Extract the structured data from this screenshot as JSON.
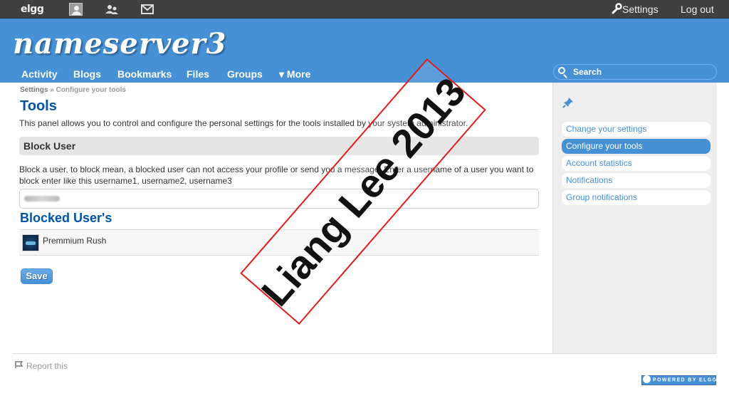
{
  "topbar": {
    "logo_text": "elgg",
    "avatar_icon": "user-avatar-icon",
    "friends_icon": "friends-icon",
    "messages_icon": "envelope-icon",
    "settings_label": "Settings",
    "logout_label": "Log out"
  },
  "header": {
    "site_name": "nameserver3",
    "menu": [
      {
        "label": "Activity"
      },
      {
        "label": "Blogs"
      },
      {
        "label": "Bookmarks"
      },
      {
        "label": "Files"
      },
      {
        "label": "Groups"
      },
      {
        "label": "▾ More"
      }
    ],
    "search_placeholder": "Search"
  },
  "breadcrumb": {
    "root": "Settings",
    "separator": "»",
    "current": "Configure your tools"
  },
  "page": {
    "title": "Tools",
    "intro": "This panel allows you to control and configure the personal settings for the tools installed by your system administrator.",
    "block_heading": "Block User",
    "block_description": "Block a user, to block mean, a blocked user can not access your profile or send you a message. Enter a username of a user you want to block enter like this username1, username2, username3",
    "blocked_title": "Blocked User's",
    "blocked_users": [
      {
        "name": "Premmium Rush"
      }
    ],
    "save_label": "Save"
  },
  "sidebar": {
    "items": [
      {
        "label": "Change your settings",
        "active": false
      },
      {
        "label": "Configure your tools",
        "active": true
      },
      {
        "label": "Account statistics",
        "active": false
      },
      {
        "label": "Notifications",
        "active": false
      },
      {
        "label": "Group notifications",
        "active": false
      }
    ]
  },
  "footer": {
    "report_label": "Report this",
    "powered_label": "POWERED BY ELGG"
  },
  "watermark": {
    "text": "Liang Lee 2013"
  },
  "colors": {
    "brand_blue": "#4690d6",
    "title_blue": "#0054a7",
    "topbar": "#404040",
    "watermark_border": "#e11b1b"
  }
}
